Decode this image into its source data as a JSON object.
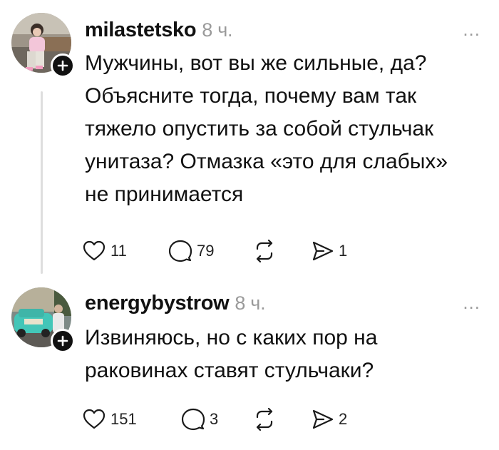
{
  "posts": [
    {
      "username": "milastetsko",
      "time": "8 ч.",
      "more": "...",
      "lines": [
        "Мужчины, вот вы же сильные, да?",
        "Объясните тогда, почему вам так",
        "тяжело опустить за собой стульчак",
        "унитаза? Отмазка «это для слабых»",
        "не принимается"
      ],
      "likes": "11",
      "comments": "79",
      "reposts": "",
      "shares": "1"
    },
    {
      "username": "energybystrow",
      "time": "8 ч.",
      "more": "...",
      "lines": [
        "Извиняюсь, но с каких пор на",
        "раковинах ставят стульчаки?"
      ],
      "likes": "151",
      "comments": "3",
      "reposts": "",
      "shares": "2"
    }
  ],
  "icons": {
    "like": "heart-icon",
    "comment": "comment-bubble-icon",
    "repost": "repost-arrows-icon",
    "share": "send-icon",
    "follow": "plus-icon",
    "more": "more-dots-icon"
  },
  "colors": {
    "text": "#111111",
    "muted": "#9a9a9a",
    "thread_line": "#dedede",
    "badge": "#111111"
  }
}
